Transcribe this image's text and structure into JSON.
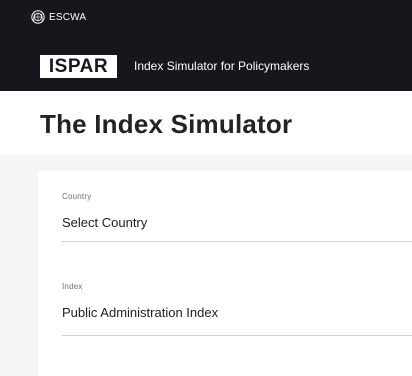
{
  "header": {
    "org_name": "ESCWA",
    "logo_text": "ISPAR",
    "subtitle": "Index Simulator for Policymakers"
  },
  "page": {
    "title": "The Index Simulator"
  },
  "form": {
    "country": {
      "label": "Country",
      "value": "Select Country"
    },
    "index": {
      "label": "Index",
      "value": "Public Administration Index"
    }
  },
  "colors": {
    "header_bg": "#16171d",
    "panel_bg": "#f5f5f5",
    "title_text": "#222326"
  },
  "icons": {
    "org_emblem": "un-emblem-icon"
  }
}
